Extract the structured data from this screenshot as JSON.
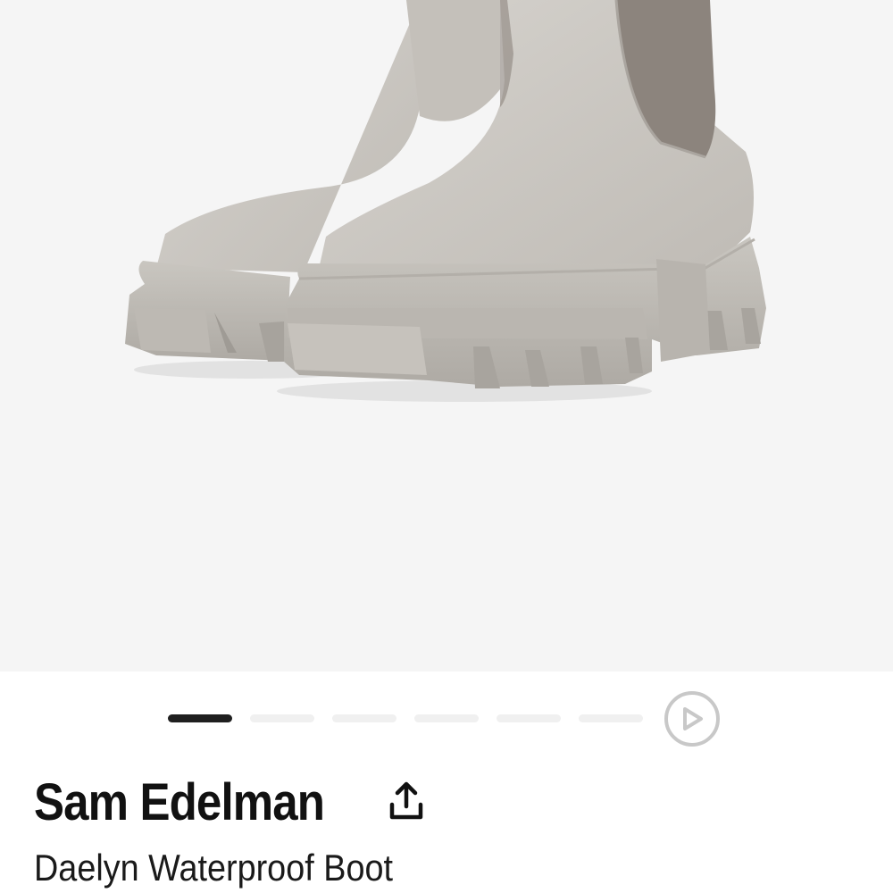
{
  "product_image": {
    "icon": "boot-product-image",
    "background_color": "#f5f5f5",
    "boot_color": "#cbc8c3",
    "elastic_color": "#8c847d"
  },
  "carousel": {
    "slides": 6,
    "active_index": 0,
    "active_color": "#1f1f1f",
    "inactive_color": "#f0f0f0",
    "play_icon": "play-icon"
  },
  "product": {
    "brand": "Sam Edelman",
    "share_icon": "share-icon",
    "name": "Daelyn Waterproof Boot"
  }
}
